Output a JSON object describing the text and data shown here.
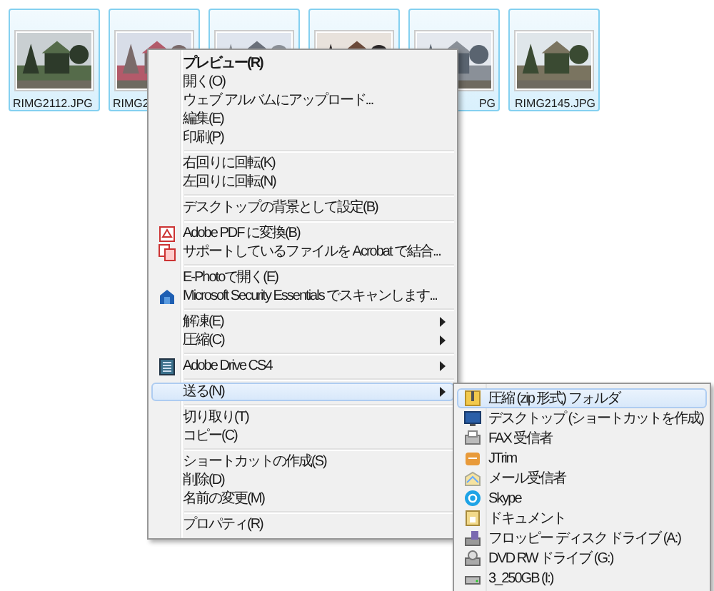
{
  "thumbnails": [
    {
      "caption": "RIMG2112.JPG",
      "selected": true
    },
    {
      "caption": "RIMG2",
      "selected": true
    },
    {
      "selected": true
    },
    {
      "selected": true
    },
    {
      "caption": "PG",
      "selected": true
    },
    {
      "caption": "RIMG2145.JPG",
      "selected": true
    }
  ],
  "context_menu": {
    "items": [
      {
        "kind": "item",
        "label": "プレビュー(R)",
        "bold": true
      },
      {
        "kind": "item",
        "label": "開く(O)"
      },
      {
        "kind": "item",
        "label": "ウェブ アルバムにアップロード..."
      },
      {
        "kind": "item",
        "label": "編集(E)"
      },
      {
        "kind": "item",
        "label": "印刷(P)"
      },
      {
        "kind": "separator"
      },
      {
        "kind": "item",
        "label": "右回りに回転(K)"
      },
      {
        "kind": "item",
        "label": "左回りに回転(N)"
      },
      {
        "kind": "separator"
      },
      {
        "kind": "item",
        "label": "デスクトップの背景として設定(B)"
      },
      {
        "kind": "separator"
      },
      {
        "kind": "item",
        "label": "Adobe PDF に変換(B)",
        "has_icon": true
      },
      {
        "kind": "item",
        "label": "サポートしているファイルを Acrobat で結合...",
        "has_icon": true
      },
      {
        "kind": "separator"
      },
      {
        "kind": "item",
        "label": "E-Photoで開く(E)"
      },
      {
        "kind": "item",
        "label": "Microsoft Security Essentials でスキャンします...",
        "has_icon": true
      },
      {
        "kind": "separator"
      },
      {
        "kind": "item",
        "label": "解凍(E)",
        "has_submenu": true
      },
      {
        "kind": "item",
        "label": "圧縮(C)",
        "has_submenu": true
      },
      {
        "kind": "separator"
      },
      {
        "kind": "item",
        "label": "Adobe Drive CS4",
        "has_submenu": true,
        "has_icon": true
      },
      {
        "kind": "separator"
      },
      {
        "kind": "item",
        "label": "送る(N)",
        "has_submenu": true,
        "selected": true
      },
      {
        "kind": "separator"
      },
      {
        "kind": "item",
        "label": "切り取り(T)"
      },
      {
        "kind": "item",
        "label": "コピー(C)"
      },
      {
        "kind": "separator"
      },
      {
        "kind": "item",
        "label": "ショートカットの作成(S)"
      },
      {
        "kind": "item",
        "label": "削除(D)"
      },
      {
        "kind": "item",
        "label": "名前の変更(M)"
      },
      {
        "kind": "separator"
      },
      {
        "kind": "item",
        "label": "プロパティ(R)"
      }
    ]
  },
  "send_to_menu": {
    "items": [
      {
        "label": "圧縮 (zip 形式) フォルダ",
        "selected": true
      },
      {
        "label": "デスクトップ (ショートカットを作成)",
        "selected": false
      },
      {
        "label": "FAX 受信者",
        "selected": false
      },
      {
        "label": "JTrim",
        "selected": false
      },
      {
        "label": "メール受信者",
        "selected": false
      },
      {
        "label": "Skype",
        "selected": false
      },
      {
        "label": "ドキュメント",
        "selected": false
      },
      {
        "label": "フロッピー ディスク ドライブ (A:)",
        "selected": false
      },
      {
        "label": "DVD RW ドライブ (G:)",
        "selected": false
      },
      {
        "label": "3_250GB (I:)",
        "selected": false
      }
    ]
  }
}
